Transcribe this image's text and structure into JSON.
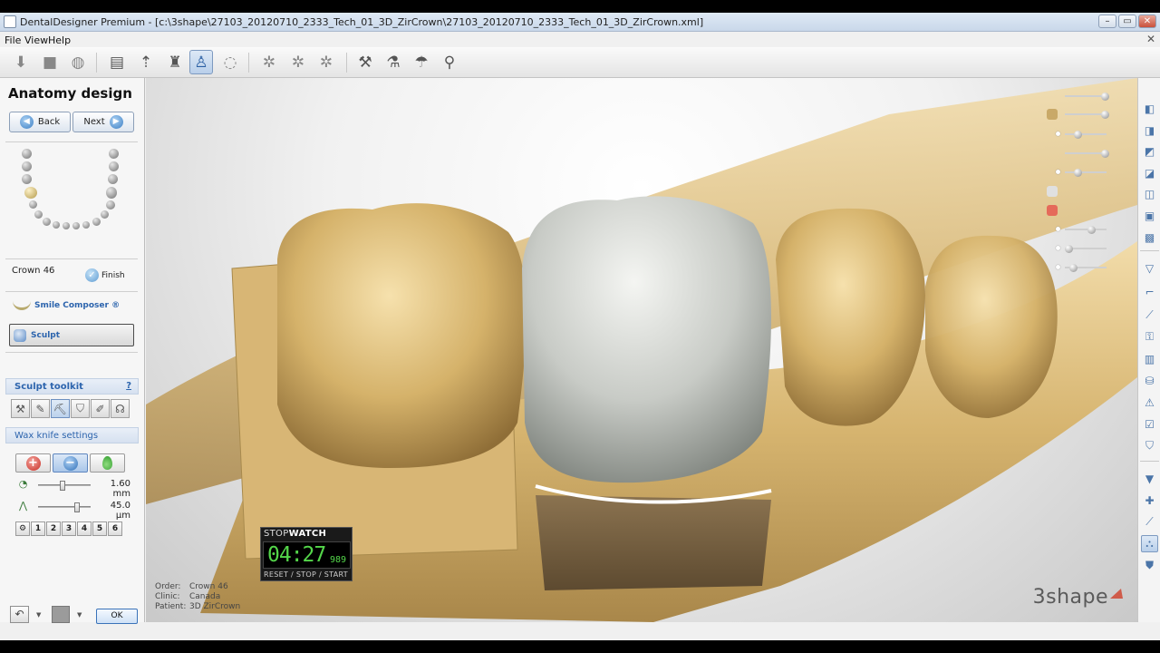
{
  "window": {
    "title": "DentalDesigner Premium - [c:\\3shape\\27103_20120710_2333_Tech_01_3D_ZirCrown\\27103_20120710_2333_Tech_01_3D_ZirCrown.xml]",
    "minimize": "–",
    "maximize": "▭",
    "close": "✕"
  },
  "menu": {
    "file": "File",
    "view": "View",
    "help": "Help",
    "mdi_close": "✕"
  },
  "left_panel": {
    "step_title": "Anatomy design",
    "back_label": "Back",
    "next_label": "Next",
    "crown_label": "Crown 46",
    "finish_label": "Finish",
    "smile_composer_label": "Smile Composer ®",
    "sculpt_label": "Sculpt",
    "sculpt_toolkit_label": "Sculpt toolkit",
    "help_label": "?",
    "wax_knife_label": "Wax knife settings",
    "wax_radius_value": "1.60 mm",
    "wax_depth_value": "45.0 µm",
    "presets": [
      "1",
      "2",
      "3",
      "4",
      "5",
      "6"
    ],
    "ok_label": "OK"
  },
  "case_info": {
    "order_key": "Order:",
    "order_value": "Crown 46",
    "clinic_key": "Clinic:",
    "clinic_value": "Canada",
    "patient_key": "Patient:",
    "patient_value": "3D ZirCrown"
  },
  "logo_text": "3shape",
  "stopwatch": {
    "title_a": "STOP",
    "title_b": "WATCH",
    "time": "04:27",
    "millis": "989",
    "controls": "RESET / STOP / START"
  },
  "colors": {
    "accent": "#2c64ad",
    "stopwatch_digits": "#54d64a",
    "gypsum": "#d9b674",
    "crown": "#c8cbc6",
    "logo_mark": "#cf5b4a"
  }
}
